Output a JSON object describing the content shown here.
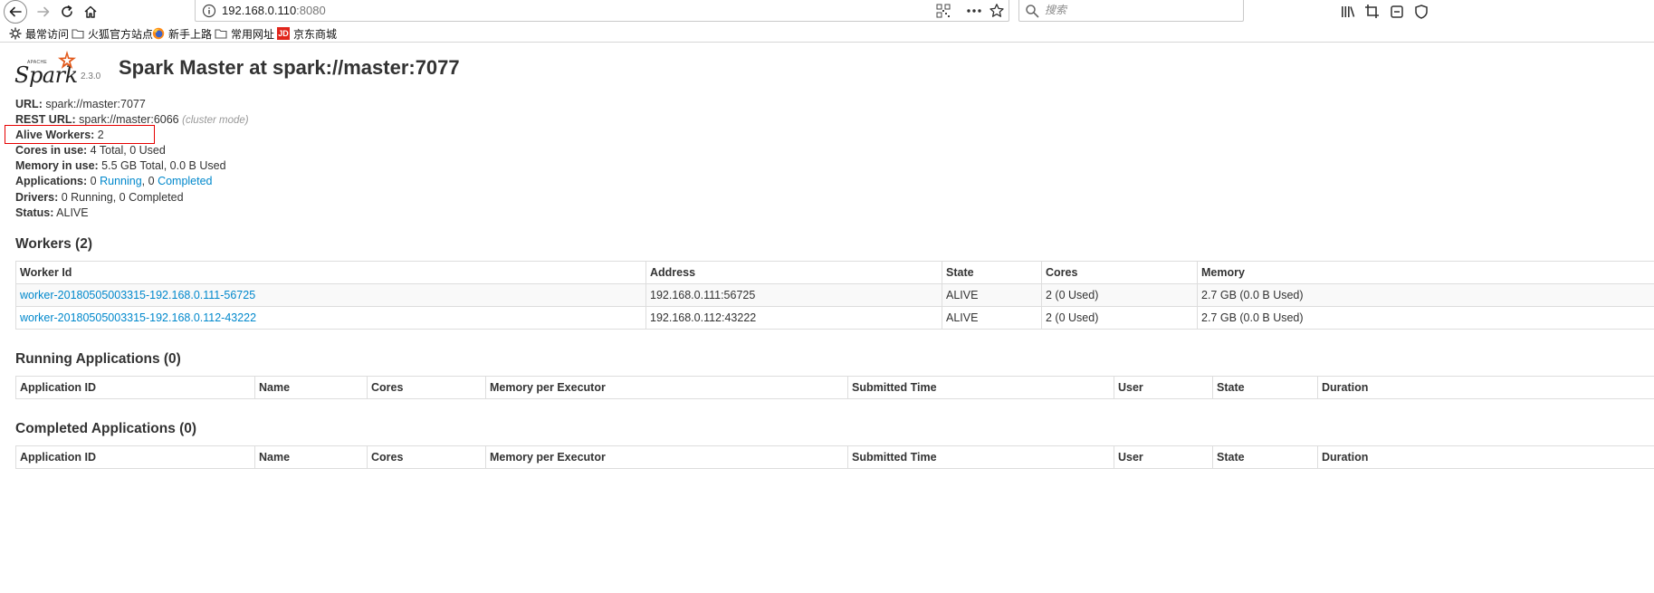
{
  "browser": {
    "url_host": "192.168.0.110",
    "url_port": ":8080",
    "search_placeholder": "搜索",
    "bookmarks": [
      {
        "label": "最常访问",
        "icon": "gear-icon"
      },
      {
        "label": "火狐官方站点",
        "icon": "folder-icon"
      },
      {
        "label": "新手上路",
        "icon": "firefox-icon"
      },
      {
        "label": "常用网址",
        "icon": "folder-icon"
      },
      {
        "label": "京东商城",
        "icon": "jd-icon",
        "icon_text": "JD"
      }
    ]
  },
  "header": {
    "logo_apache": "APACHE",
    "logo_text": "Spark",
    "version": "2.3.0",
    "title": "Spark Master at spark://master:7077"
  },
  "info": {
    "url_label": "URL:",
    "url_value": "spark://master:7077",
    "rest_label": "REST URL:",
    "rest_value": "spark://master:6066",
    "rest_mode": "(cluster mode)",
    "alive_label": "Alive Workers:",
    "alive_value": "2",
    "cores_label": "Cores in use:",
    "cores_value": "4 Total, 0 Used",
    "memory_label": "Memory in use:",
    "memory_value": "5.5 GB Total, 0.0 B Used",
    "apps_label": "Applications:",
    "apps_running_count": "0",
    "apps_running_link": "Running",
    "apps_sep": ", 0",
    "apps_completed_link": "Completed",
    "drivers_label": "Drivers:",
    "drivers_value": "0 Running, 0 Completed",
    "status_label": "Status:",
    "status_value": "ALIVE"
  },
  "workers": {
    "title": "Workers (2)",
    "columns": [
      "Worker Id",
      "Address",
      "State",
      "Cores",
      "Memory"
    ],
    "rows": [
      {
        "id": "worker-20180505003315-192.168.0.111-56725",
        "address": "192.168.0.111:56725",
        "state": "ALIVE",
        "cores": "2 (0 Used)",
        "memory": "2.7 GB (0.0 B Used)"
      },
      {
        "id": "worker-20180505003315-192.168.0.112-43222",
        "address": "192.168.0.112:43222",
        "state": "ALIVE",
        "cores": "2 (0 Used)",
        "memory": "2.7 GB (0.0 B Used)"
      }
    ]
  },
  "running_apps": {
    "title": "Running Applications (0)",
    "columns": [
      "Application ID",
      "Name",
      "Cores",
      "Memory per Executor",
      "Submitted Time",
      "User",
      "State",
      "Duration"
    ]
  },
  "completed_apps": {
    "title": "Completed Applications (0)",
    "columns": [
      "Application ID",
      "Name",
      "Cores",
      "Memory per Executor",
      "Submitted Time",
      "User",
      "State",
      "Duration"
    ]
  },
  "colors": {
    "link": "#0088cc",
    "highlight": "#e60000",
    "logo_star": "#e25a1c"
  }
}
